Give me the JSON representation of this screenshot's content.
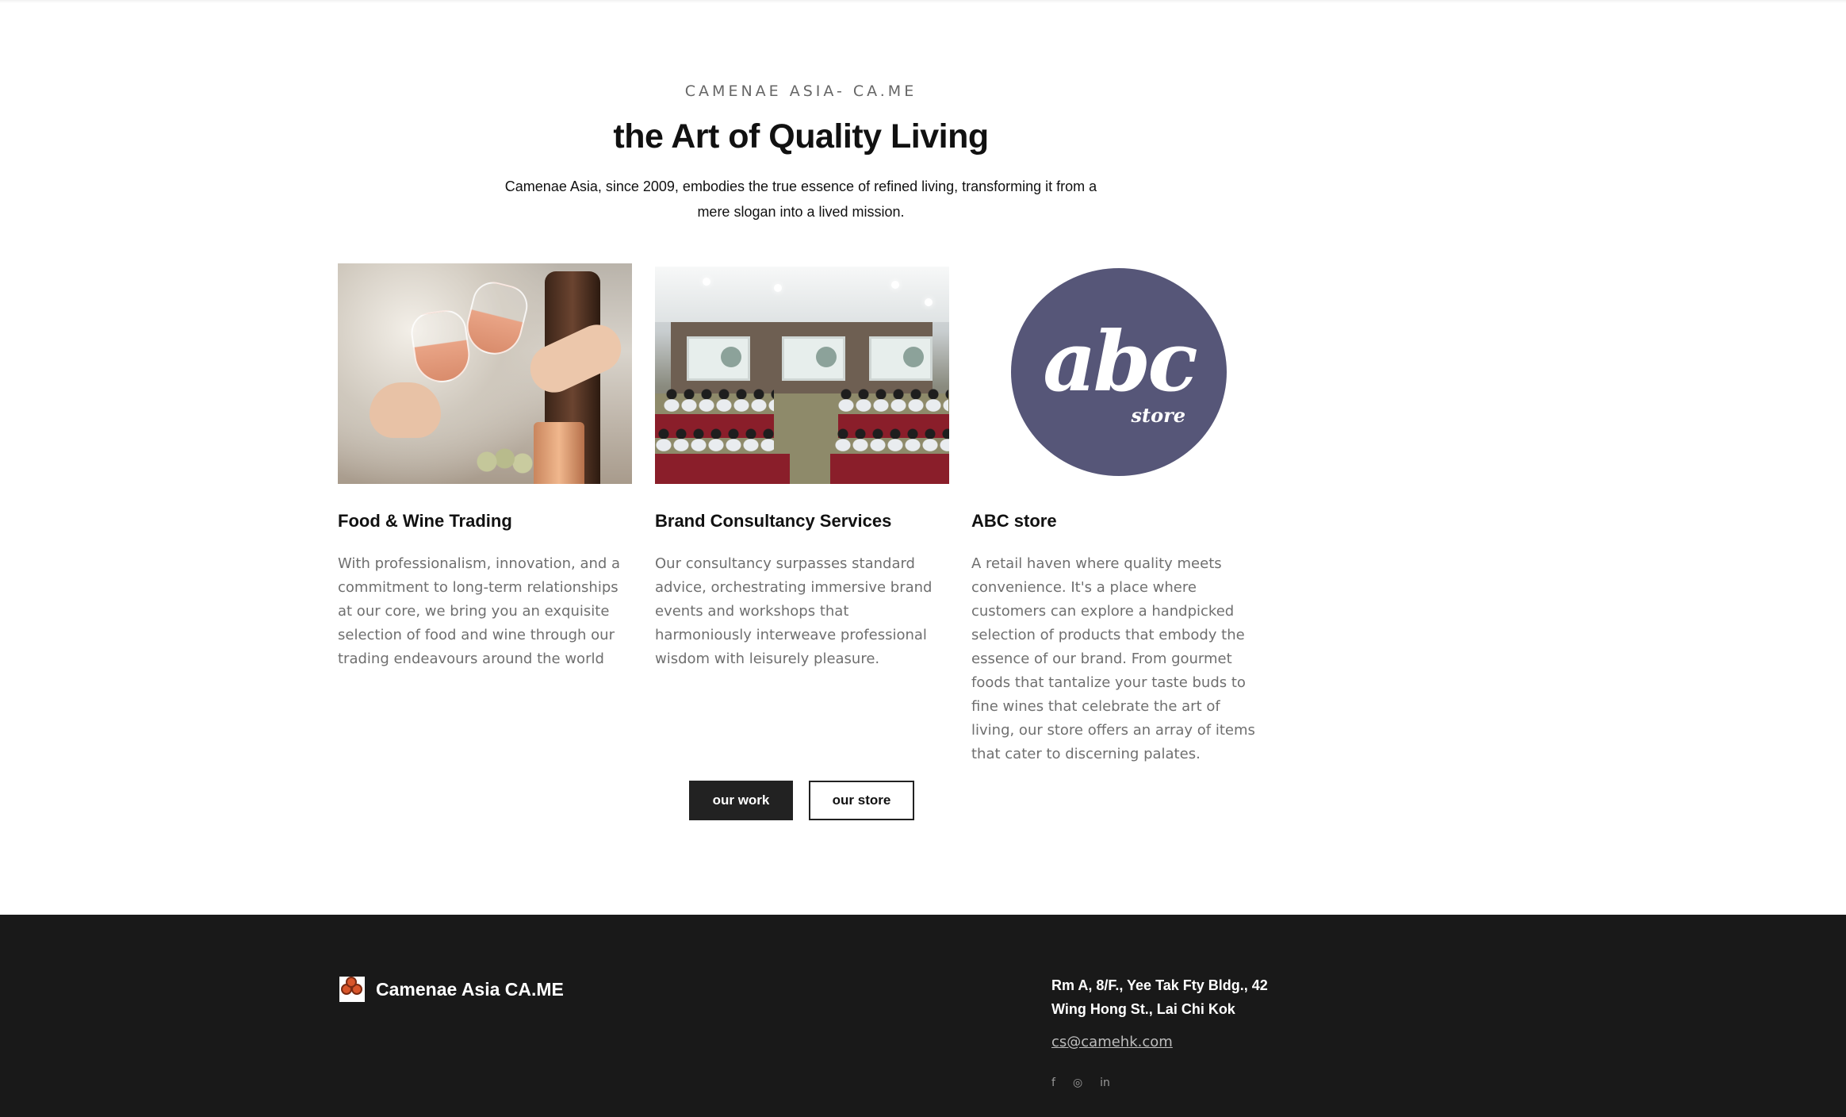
{
  "intro": {
    "eyebrow": "CAMENAE ASIA- CA.ME",
    "title": "the Art of Quality Living",
    "description": "Camenae Asia, since 2009, embodies the true essence of refined living, transforming it from a mere slogan into a lived mission."
  },
  "cards": [
    {
      "title": "Food & Wine Trading",
      "body": "With professionalism, innovation, and a commitment to long-term relationships at our core, we bring you an exquisite selection of food and wine through our trading endeavours around the world"
    },
    {
      "title": "Brand Consultancy Services",
      "body": "Our consultancy surpasses standard advice, orchestrating immersive brand events and workshops that harmoniously interweave professional wisdom with leisurely pleasure."
    },
    {
      "title": "ABC store",
      "body": "A retail haven where quality meets convenience. It's a place where customers can explore a handpicked selection of products that embody the essence of our brand. From gourmet foods that tantalize your taste buds to fine wines that celebrate the art of living, our store offers an array of items that cater to discerning palates.",
      "logo_word": "abc",
      "logo_sub": "store"
    }
  ],
  "buttons": {
    "work": "our work",
    "store": "our store"
  },
  "footer": {
    "brand": "Camenae Asia CA.ME",
    "address_line1": "Rm A, 8/F., Yee Tak Fty Bldg., 42",
    "address_line2": "Wing Hong St., Lai Chi Kok",
    "email": "cs@camehk.com",
    "social": {
      "facebook": "f",
      "instagram": "◎",
      "linkedin": "in"
    }
  },
  "colors": {
    "footer_bg": "#191919",
    "button_dark": "#222222",
    "abc_logo": "#565678"
  }
}
